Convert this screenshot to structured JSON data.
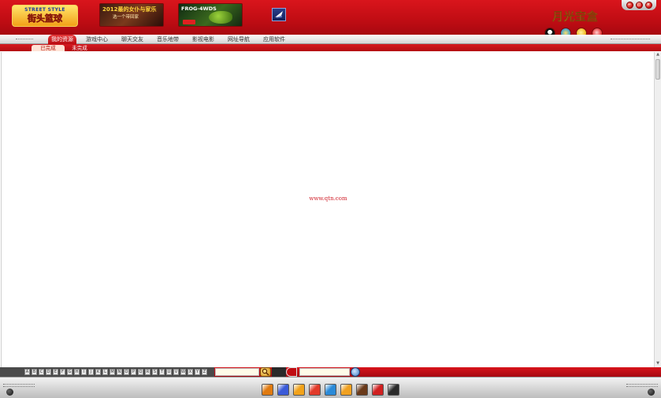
{
  "header": {
    "logo_top": "STREET STYLE",
    "logo_main": "街头篮球",
    "banner1": {
      "line1": "2012最的女仆与家乐",
      "line2": "选一个带回家"
    },
    "banner2": {
      "line1": "FROG-4WDS"
    },
    "brand": "月光宝盒",
    "window_controls": [
      "−",
      "□",
      "×"
    ]
  },
  "nav": {
    "tabs": [
      {
        "label": "我的资源",
        "active": true
      },
      {
        "label": "游戏中心",
        "active": false
      },
      {
        "label": "聊天交友",
        "active": false
      },
      {
        "label": "音乐地带",
        "active": false
      },
      {
        "label": "影视电影",
        "active": false
      },
      {
        "label": "网址导航",
        "active": false
      },
      {
        "label": "应用软件",
        "active": false
      }
    ],
    "icons": [
      "qq-penguin-icon",
      "mail-icon",
      "smile-icon",
      "rabbit-icon"
    ]
  },
  "subtabs": {
    "completed": "已完成",
    "incomplete": "未完成"
  },
  "content": {
    "url_text": "www.qtn.com"
  },
  "bottombar": {
    "letters": [
      "A",
      "B",
      "C",
      "D",
      "E",
      "F",
      "G",
      "H",
      "I",
      "J",
      "K",
      "L",
      "M",
      "N",
      "O",
      "P",
      "Q",
      "R",
      "S",
      "T",
      "U",
      "V",
      "W",
      "X",
      "Y",
      "Z"
    ],
    "search_value": "",
    "url_value": ""
  },
  "dock": {
    "icons": [
      {
        "name": "app1-icon",
        "color": "#e07a10"
      },
      {
        "name": "app2-icon",
        "color": "#3a5ad8"
      },
      {
        "name": "app3-icon",
        "color": "#f2a21a"
      },
      {
        "name": "app4-icon",
        "color": "#e23a2a"
      },
      {
        "name": "app5-icon",
        "color": "#2a8ad8"
      },
      {
        "name": "app6-icon",
        "color": "#f0a020"
      },
      {
        "name": "app7-icon",
        "color": "#6a3a1a"
      },
      {
        "name": "app8-icon",
        "color": "#d02020"
      },
      {
        "name": "app9-icon",
        "color": "#2a2a2a"
      }
    ]
  },
  "colors": {
    "primary_red": "#c20d14",
    "brand_gold": "#ffd43a"
  }
}
